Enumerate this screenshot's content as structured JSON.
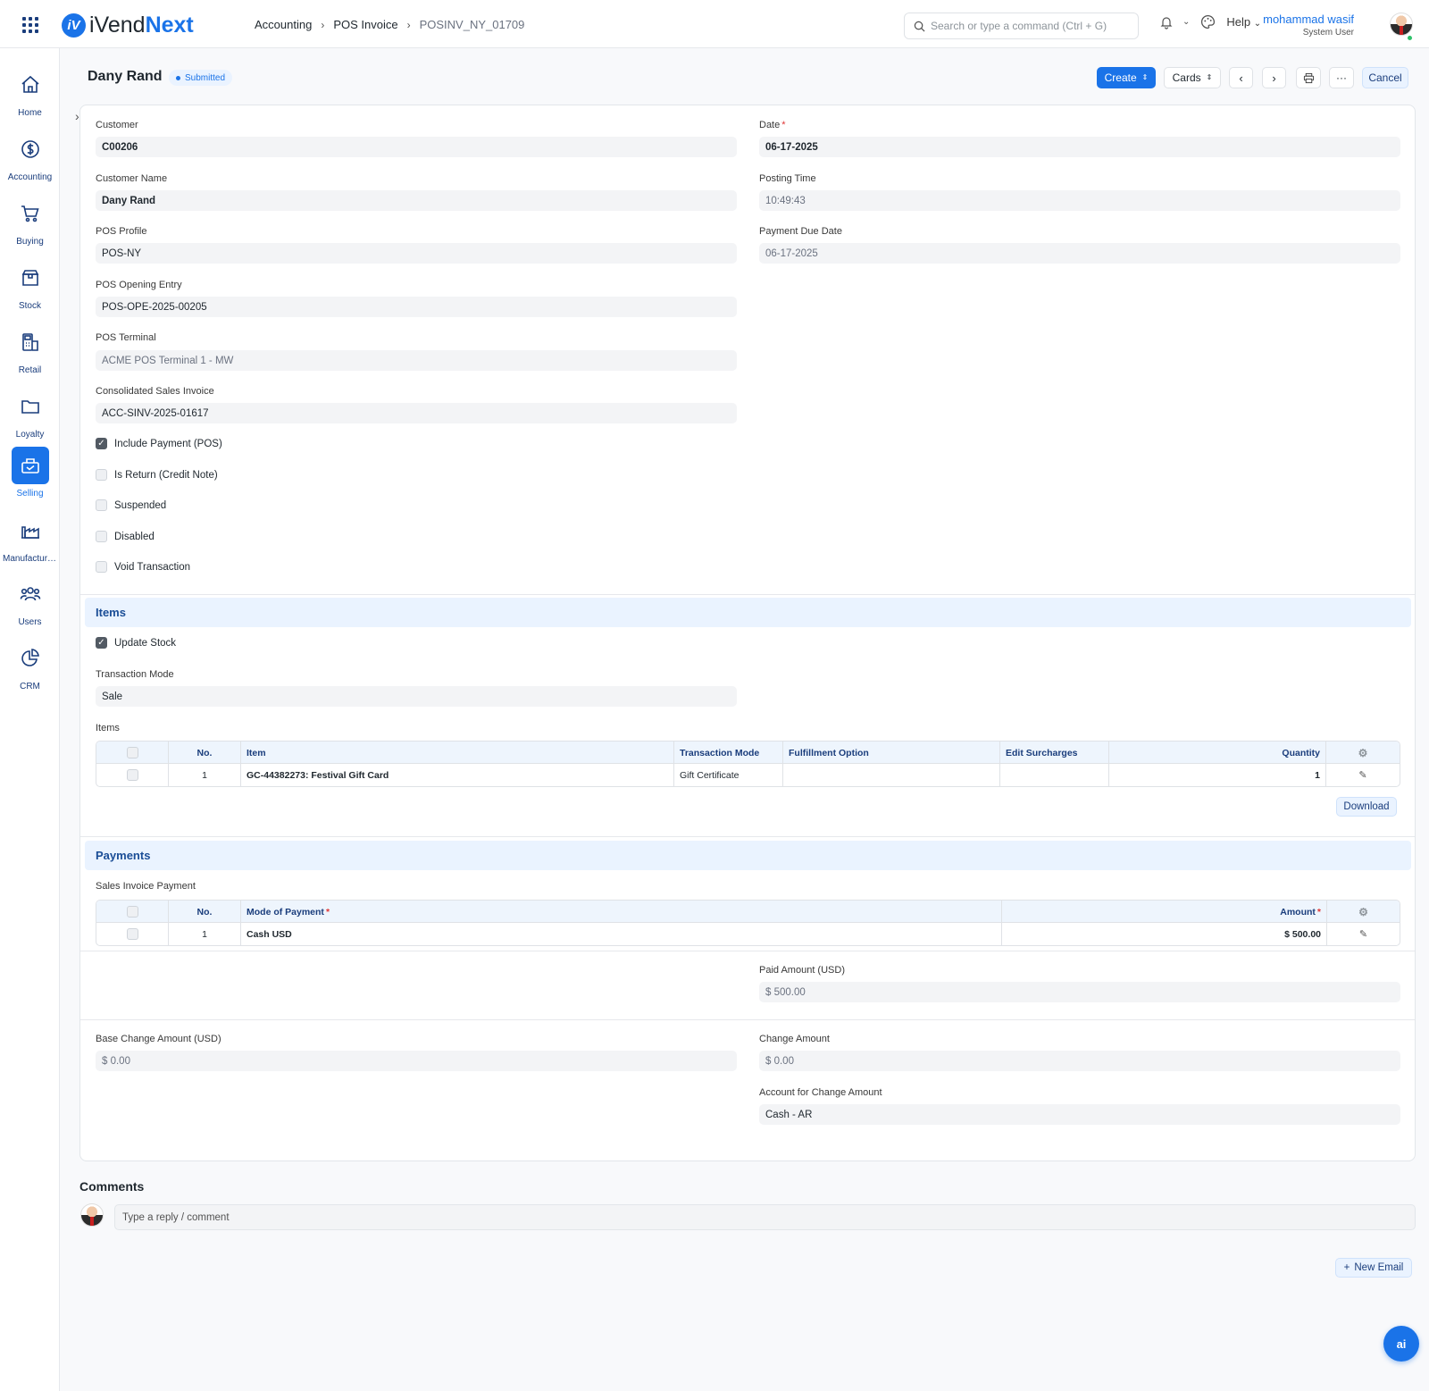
{
  "app": {
    "logo_mark": "iV",
    "logo_text_a": "iVend",
    "logo_text_b": "Next"
  },
  "breadcrumb": [
    "Accounting",
    "POS Invoice",
    "POSINV_NY_01709"
  ],
  "search": {
    "placeholder": "Search or type a command (Ctrl + G)"
  },
  "nav": {
    "help_label": "Help"
  },
  "user": {
    "name": "mohammad wasif",
    "role": "System User"
  },
  "sidebar": {
    "items": [
      {
        "label": "Home",
        "icon": "home-icon"
      },
      {
        "label": "Accounting",
        "icon": "dollar-icon"
      },
      {
        "label": "Buying",
        "icon": "cart-icon"
      },
      {
        "label": "Stock",
        "icon": "box-icon"
      },
      {
        "label": "Retail",
        "icon": "pos-terminal-icon"
      },
      {
        "label": "Loyalty",
        "icon": "folder-icon"
      },
      {
        "label": "Selling",
        "icon": "register-icon",
        "active": true
      },
      {
        "label": "Manufacturing",
        "icon": "factory-icon"
      },
      {
        "label": "Users",
        "icon": "users-icon"
      },
      {
        "label": "CRM",
        "icon": "pie-chart-icon"
      }
    ]
  },
  "header": {
    "title": "Dany Rand",
    "status": "Submitted",
    "create_label": "Create",
    "cards_label": "Cards",
    "more_label": "···",
    "cancel_label": "Cancel"
  },
  "form": {
    "customer": {
      "label": "Customer",
      "value": "C00206"
    },
    "customer_name": {
      "label": "Customer Name",
      "value": "Dany Rand"
    },
    "pos_profile": {
      "label": "POS Profile",
      "value": "POS-NY"
    },
    "pos_opening_entry": {
      "label": "POS Opening Entry",
      "value": "POS-OPE-2025-00205"
    },
    "pos_terminal": {
      "label": "POS Terminal",
      "value": "ACME POS Terminal 1 - MW"
    },
    "consolidated_sales_invoice": {
      "label": "Consolidated Sales Invoice",
      "value": "ACC-SINV-2025-01617"
    },
    "date": {
      "label": "Date",
      "value": "06-17-2025"
    },
    "posting_time": {
      "label": "Posting Time",
      "value": "10:49:43"
    },
    "payment_due_date": {
      "label": "Payment Due Date",
      "value": "06-17-2025"
    },
    "checkboxes": [
      {
        "label": "Include Payment (POS)",
        "checked": true
      },
      {
        "label": "Is Return (Credit Note)",
        "checked": false
      },
      {
        "label": "Suspended",
        "checked": false
      },
      {
        "label": "Disabled",
        "checked": false
      },
      {
        "label": "Void Transaction",
        "checked": false
      }
    ]
  },
  "items_section": {
    "title": "Items",
    "update_stock_label": "Update Stock",
    "transaction_mode": {
      "label": "Transaction Mode",
      "value": "Sale"
    },
    "table_label": "Items",
    "columns": [
      "No.",
      "Item",
      "Transaction Mode",
      "Fulfillment Option",
      "Edit Surcharges",
      "Quantity"
    ],
    "rows": [
      {
        "no": "1",
        "item": "GC-44382273: Festival Gift Card",
        "transaction_mode": "Gift Certificate",
        "fulfillment_option": "",
        "edit_surcharges": "",
        "quantity": "1"
      }
    ],
    "download_label": "Download"
  },
  "payments_section": {
    "title": "Payments",
    "table_label": "Sales Invoice Payment",
    "columns": [
      "No.",
      "Mode of Payment",
      "Amount"
    ],
    "rows": [
      {
        "no": "1",
        "mode": "Cash USD",
        "amount": "$ 500.00"
      }
    ],
    "paid_amount": {
      "label": "Paid Amount (USD)",
      "value": "$ 500.00"
    },
    "base_change_amount": {
      "label": "Base Change Amount (USD)",
      "value": "$ 0.00"
    },
    "change_amount": {
      "label": "Change Amount",
      "value": "$ 0.00"
    },
    "account_for_change": {
      "label": "Account for Change Amount",
      "value": "Cash - AR"
    }
  },
  "comments": {
    "title": "Comments",
    "placeholder": "Type a reply / comment",
    "new_email_label": "New Email"
  },
  "ai_button_label": "ai",
  "colors": {
    "primary": "#1a73e8",
    "section_bg": "#eaf3ff",
    "sidebar_icon": "#1a3d7c"
  }
}
